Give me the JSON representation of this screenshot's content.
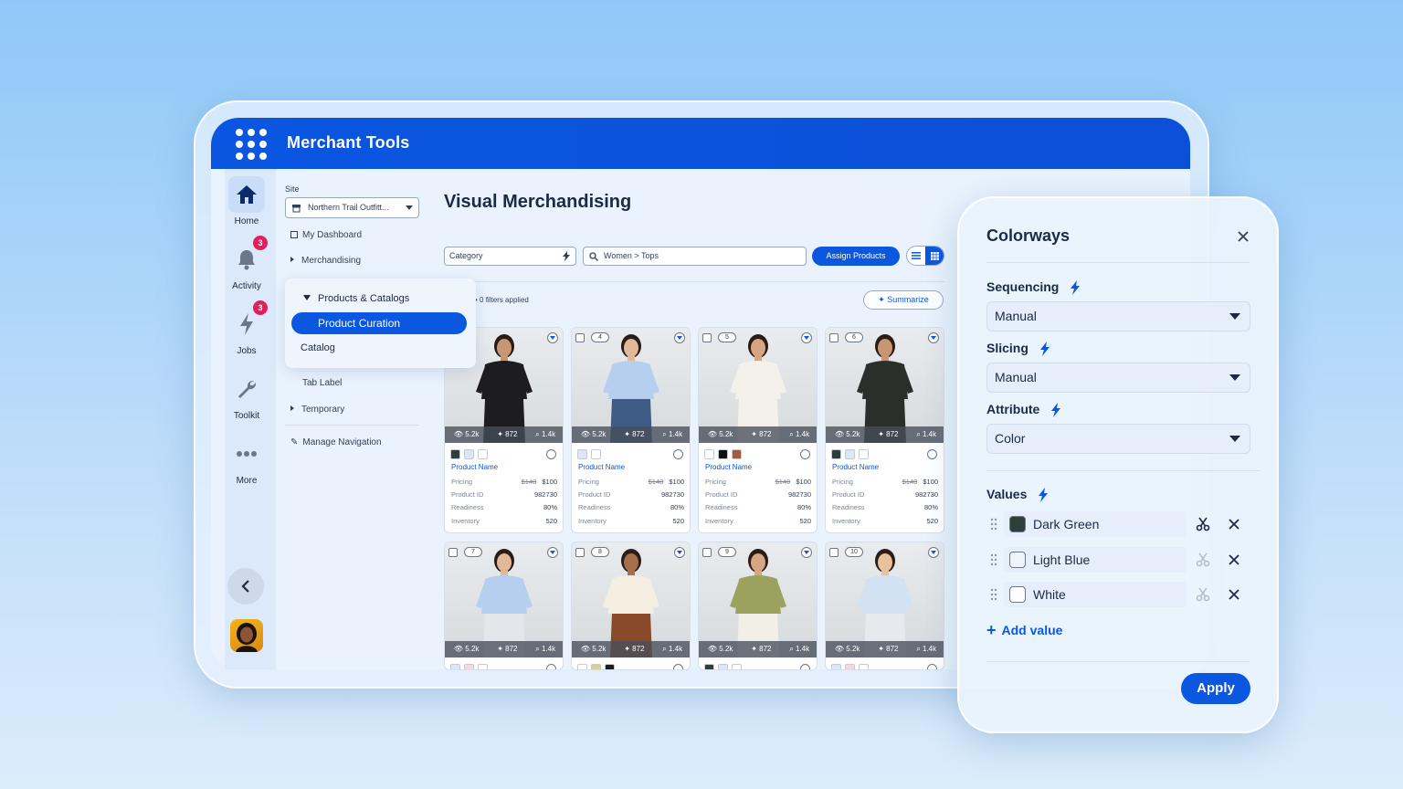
{
  "app": {
    "title": "Merchant Tools"
  },
  "rail": {
    "home": "Home",
    "activity": "Activity",
    "activity_badge": "3",
    "jobs": "Jobs",
    "jobs_badge": "3",
    "toolkit": "Toolkit",
    "more": "More"
  },
  "nav": {
    "site_label": "Site",
    "site_value": "Northern Trail Outfitt...",
    "my_dashboard": "My Dashboard",
    "merchandising": "Merchandising",
    "products_catalogs": "Products & Catalogs",
    "product_curation": "Product Curation",
    "catalog": "Catalog",
    "tab_label": "Tab Label",
    "temporary": "Temporary",
    "manage_navigation": "Manage Navigation"
  },
  "main": {
    "title": "Visual Merchandising",
    "category_placeholder": "Category",
    "search_value": "Women > Tops",
    "assign_button": "Assign Products",
    "filters_text": "0 filters applied",
    "summarize_button": "Summarize"
  },
  "card_labels": {
    "product_name": "Product Name",
    "pricing": "Pricing",
    "product_id": "Product ID",
    "readiness": "Readiness",
    "inventory": "Inventory"
  },
  "cards": [
    {
      "num": "",
      "views": "5.2k",
      "likes": "872",
      "searches": "1.4k",
      "old_price": "$140",
      "price": "$100",
      "product_id": "982730",
      "readiness": "80%",
      "inventory": "520",
      "swatches": [
        "#2e3f3a",
        "#dbe7f7",
        "#ffffff"
      ],
      "shirt": "#1d1d1f",
      "pants": "#1d1d1f",
      "skin": "#c99674"
    },
    {
      "num": "4",
      "views": "5.2k",
      "likes": "872",
      "searches": "1.4k",
      "old_price": "$140",
      "price": "$100",
      "product_id": "982730",
      "readiness": "80%",
      "inventory": "520",
      "swatches": [
        "#dbe7f7",
        "#ffffff"
      ],
      "shirt": "#b7cfee",
      "pants": "#3f5c86",
      "skin": "#e2b89a"
    },
    {
      "num": "5",
      "views": "5.2k",
      "likes": "872",
      "searches": "1.4k",
      "old_price": "$140",
      "price": "$100",
      "product_id": "982730",
      "readiness": "80%",
      "inventory": "520",
      "swatches": [
        "#ffffff",
        "#111111",
        "#a15a3e"
      ],
      "shirt": "#f4f1ea",
      "pants": "#f4f1ea",
      "skin": "#d6a582"
    },
    {
      "num": "6",
      "views": "5.2k",
      "likes": "872",
      "searches": "1.4k",
      "old_price": "$140",
      "price": "$100",
      "product_id": "982730",
      "readiness": "80%",
      "inventory": "520",
      "swatches": [
        "#2e3f3a",
        "#dbe7f7",
        "#ffffff"
      ],
      "shirt": "#2a2f2c",
      "pants": "#2a2f2c",
      "skin": "#c99674"
    },
    {
      "num": "7",
      "views": "5.2k",
      "likes": "872",
      "searches": "1.4k",
      "swatches": [
        "#dbe7f7",
        "#f6d8e3",
        "#ffffff"
      ],
      "shirt": "#b7cfee",
      "pants": "#e3e6ea",
      "skin": "#e2b89a"
    },
    {
      "num": "8",
      "views": "5.2k",
      "likes": "872",
      "searches": "1.4k",
      "swatches": [
        "#ffffff",
        "#d8ce9e",
        "#1d1d1f"
      ],
      "shirt": "#f5efe2",
      "pants": "#8a4a2a",
      "skin": "#a86f4c"
    },
    {
      "num": "9",
      "views": "5.2k",
      "likes": "872",
      "searches": "1.4k",
      "swatches": [
        "#2e3f3a",
        "#dbe7f7",
        "#ffffff"
      ],
      "shirt": "#9ba25e",
      "pants": "#f2efe6",
      "skin": "#d6a582"
    },
    {
      "num": "10",
      "views": "5.2k",
      "likes": "872",
      "searches": "1.4k",
      "swatches": [
        "#dbe7f7",
        "#f6d8e3",
        "#ffffff"
      ],
      "shirt": "#d3e2f3",
      "pants": "#e6e9ee",
      "skin": "#e8c29f"
    }
  ],
  "colorways": {
    "title": "Colorways",
    "sequencing_label": "Sequencing",
    "sequencing_value": "Manual",
    "slicing_label": "Slicing",
    "slicing_value": "Manual",
    "attribute_label": "Attribute",
    "attribute_value": "Color",
    "values_label": "Values",
    "values": [
      {
        "name": "Dark Green",
        "color": "#2e3f3a"
      },
      {
        "name": "Light Blue",
        "color": "#eef4fb"
      },
      {
        "name": "White",
        "color": "#ffffff"
      }
    ],
    "add_value": "Add value",
    "apply": "Apply"
  },
  "colors": {
    "accent": "#0b57e0",
    "badge": "#e21e5c"
  }
}
